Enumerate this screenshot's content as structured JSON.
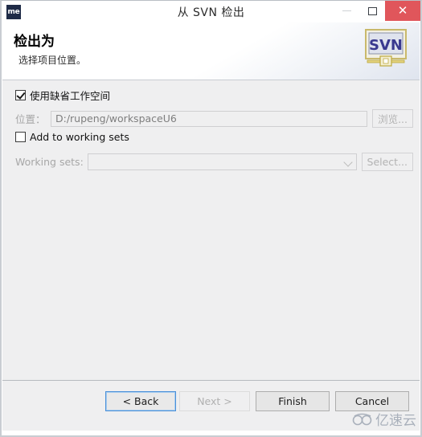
{
  "window": {
    "title": "从 SVN 检出",
    "app_icon_text": "me",
    "controls": {
      "minimize": "minimize-icon",
      "maximize": "maximize-icon",
      "close": "✕"
    }
  },
  "header": {
    "title": "检出为",
    "subtitle": "选择项目位置。",
    "logo_text": "SVN"
  },
  "content": {
    "default_workspace": {
      "label": "使用缺省工作空间",
      "checked": true
    },
    "location": {
      "label": "位置：",
      "value": "D:/rupeng/workspaceU6",
      "browse_label": "浏览..."
    },
    "add_to_working_sets": {
      "label": "Add to working sets",
      "checked": false
    },
    "working_sets": {
      "label": "Working sets:",
      "value": "",
      "select_label": "Select..."
    }
  },
  "buttons": {
    "back": "< Back",
    "next": "Next >",
    "finish": "Finish",
    "cancel": "Cancel"
  },
  "watermark": {
    "text": "亿速云"
  },
  "colors": {
    "close_button": "#e0565b",
    "focus_border": "#4a90d9",
    "content_bg": "#efeff0",
    "app_icon_bg": "#1f2b47"
  }
}
